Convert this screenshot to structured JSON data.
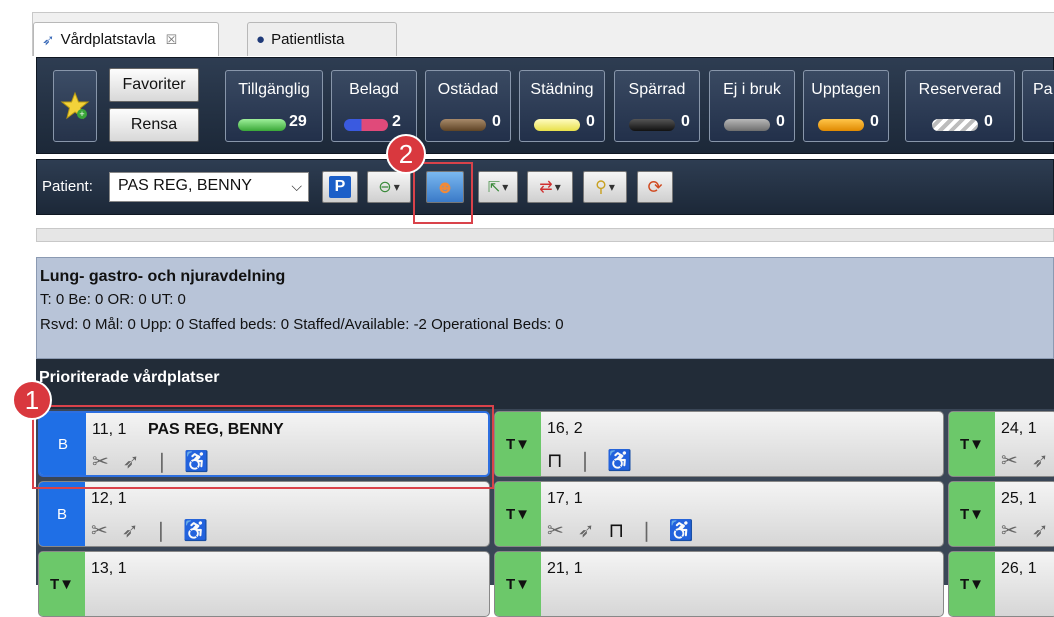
{
  "tabs": [
    {
      "label": "Vårdplatstavla",
      "close": "☒"
    },
    {
      "label": "Patientlista"
    }
  ],
  "toolbar_top": {
    "favorites_label": "Favoriter",
    "clear_label": "Rensa",
    "statuses": [
      {
        "label": "Tillgänglig",
        "count": "29",
        "color": "#5cc85a"
      },
      {
        "label": "Belagd",
        "count": "2",
        "color": "#e04a7a"
      },
      {
        "label": "Ostädad",
        "count": "0",
        "color": "#7a5a3a"
      },
      {
        "label": "Städning",
        "count": "0",
        "color": "#f5f07a"
      },
      {
        "label": "Spärrad",
        "count": "0",
        "color": "#222222"
      },
      {
        "label": "Ej i bruk",
        "count": "0",
        "color": "#8a8a8a"
      },
      {
        "label": "Upptagen",
        "count": "0",
        "color": "#f5a000"
      },
      {
        "label": "Reserverad",
        "count": "0",
        "color": "#dddddd"
      },
      {
        "label": "Pa",
        "count": "",
        "color": "#cccccc"
      }
    ]
  },
  "patient_bar": {
    "label": "Patient:",
    "selected": "PAS REG, BENNY",
    "buttons": [
      "P"
    ]
  },
  "markers": [
    "1",
    "2"
  ],
  "department": {
    "title": "Lung- gastro- och njuravdelning",
    "line1": "T: 0 Be: 0 OR: 0 UT: 0",
    "line2": "Rsvd: 0 Mål: 0 Upp: 0 Staffed beds: 0 Staffed/Available: -2 Operational Beds: 0"
  },
  "priority_header": "Prioriterade vårdplatser",
  "beds": [
    {
      "num": "11, 1",
      "patient": "PAS REG, BENNY",
      "status": "B"
    },
    {
      "num": "12, 1",
      "patient": "",
      "status": "B"
    },
    {
      "num": "13, 1",
      "patient": "",
      "status": "T▼"
    },
    {
      "num": "16, 2",
      "patient": "",
      "status": "T▼"
    },
    {
      "num": "17, 1",
      "patient": "",
      "status": "T▼"
    },
    {
      "num": "21, 1",
      "patient": "",
      "status": "T▼"
    },
    {
      "num": "24, 1",
      "patient": "",
      "status": "T▼"
    },
    {
      "num": "25, 1",
      "patient": "",
      "status": "T▼"
    },
    {
      "num": "26, 1",
      "patient": "",
      "status": "T▼"
    }
  ]
}
